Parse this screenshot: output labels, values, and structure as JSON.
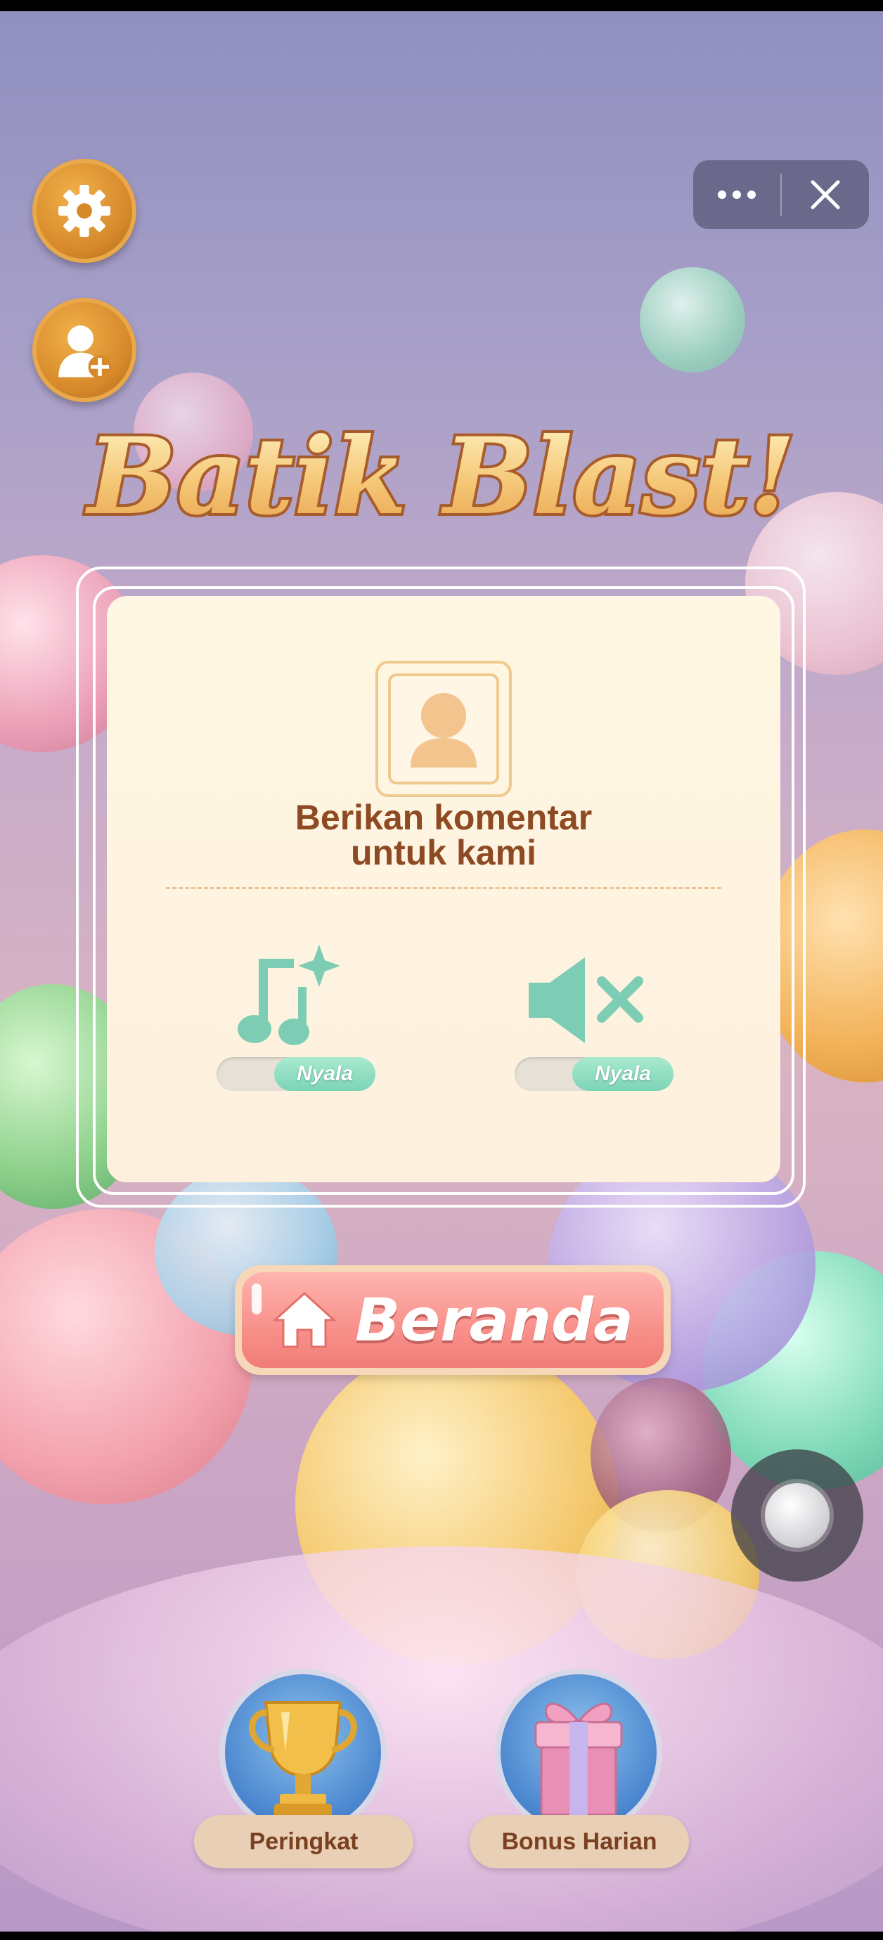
{
  "game": {
    "title": "Batik Blast!"
  },
  "mini_program_capsule": {
    "more_icon": "more-dots-icon",
    "close_icon": "close-icon"
  },
  "side_buttons": {
    "settings_icon": "gear-icon",
    "add_friend_icon": "add-user-icon"
  },
  "settings_panel": {
    "feedback_line1": "Berikan komentar",
    "feedback_line2": "untuk kami",
    "music": {
      "icon": "music-notes-icon",
      "toggle_label": "Nyala",
      "on": true
    },
    "sound": {
      "icon": "speaker-muted-icon",
      "toggle_label": "Nyala",
      "on": true
    }
  },
  "home_button": {
    "label": "Beranda",
    "icon": "home-icon"
  },
  "bottom_nav": [
    {
      "label": "Peringkat",
      "icon": "trophy-icon"
    },
    {
      "label": "Bonus Harian",
      "icon": "gift-icon"
    }
  ],
  "colors": {
    "accent_orange": "#d7892a",
    "toggle_green": "#7cd4b6",
    "home_pink": "#f8908a",
    "text_brown": "#8e4b23"
  }
}
